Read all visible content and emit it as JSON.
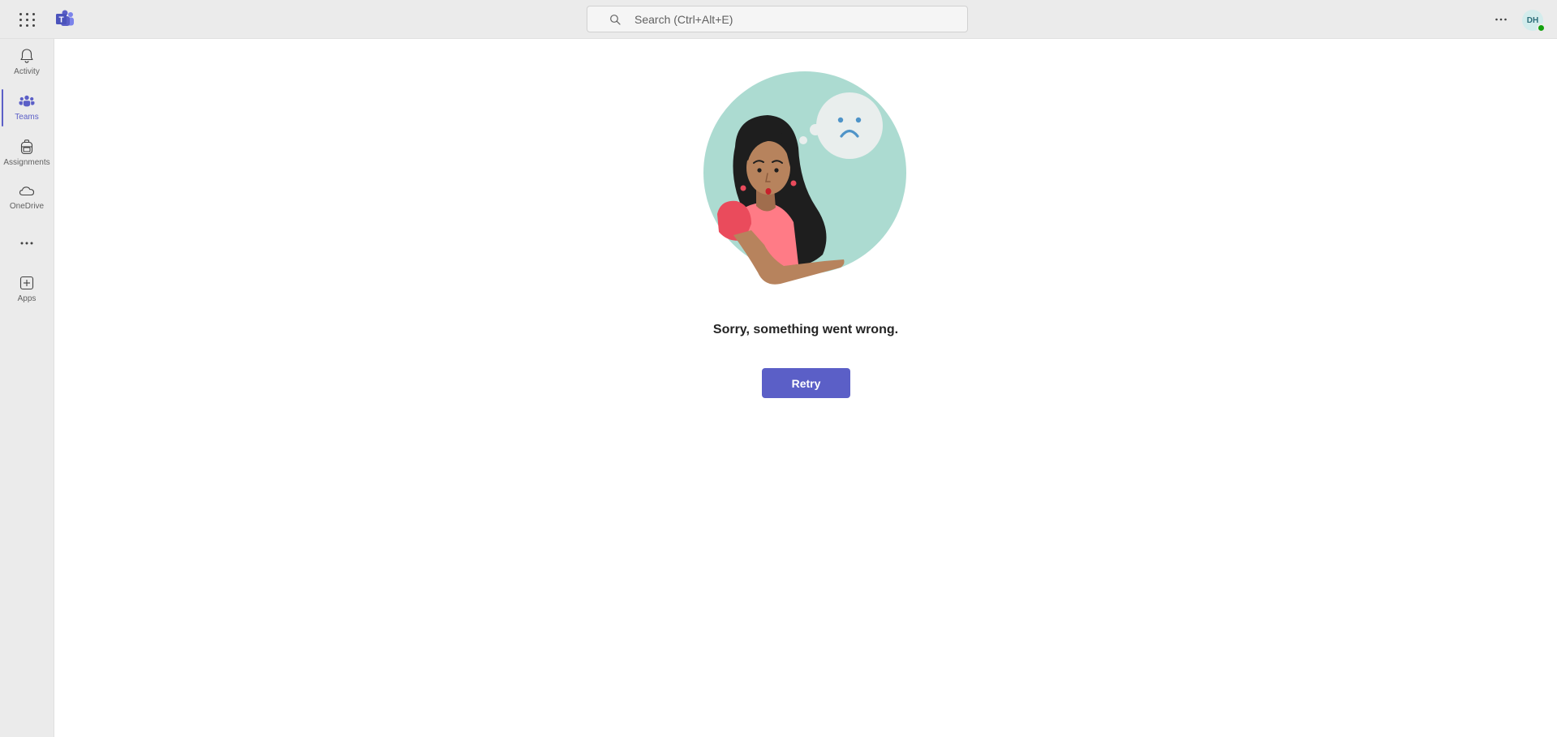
{
  "topbar": {
    "waffle_icon": "app-launcher-icon",
    "logo_icon": "teams-logo-icon",
    "search": {
      "placeholder": "Search (Ctrl+Alt+E)",
      "value": ""
    },
    "more_icon": "more-horizontal-icon",
    "avatar": {
      "initials": "DH",
      "presence": "available",
      "presence_color": "#13a10e"
    }
  },
  "sidebar": {
    "items": [
      {
        "label": "Activity",
        "icon": "bell-icon",
        "active": false
      },
      {
        "label": "Teams",
        "icon": "teams-icon",
        "active": true
      },
      {
        "label": "Assignments",
        "icon": "backpack-icon",
        "active": false
      },
      {
        "label": "OneDrive",
        "icon": "cloud-icon",
        "active": false
      },
      {
        "label": "Apps",
        "icon": "add-square-icon",
        "active": false
      }
    ],
    "more_icon": "more-horizontal-icon"
  },
  "main": {
    "illustration": "sad-woman-thought-bubble-illustration",
    "message": "Sorry, something went wrong.",
    "retry_label": "Retry"
  },
  "colors": {
    "brand": "#5b5fc7",
    "chrome_bg": "#ebebeb",
    "illustration_circle": "#acdbd1"
  }
}
